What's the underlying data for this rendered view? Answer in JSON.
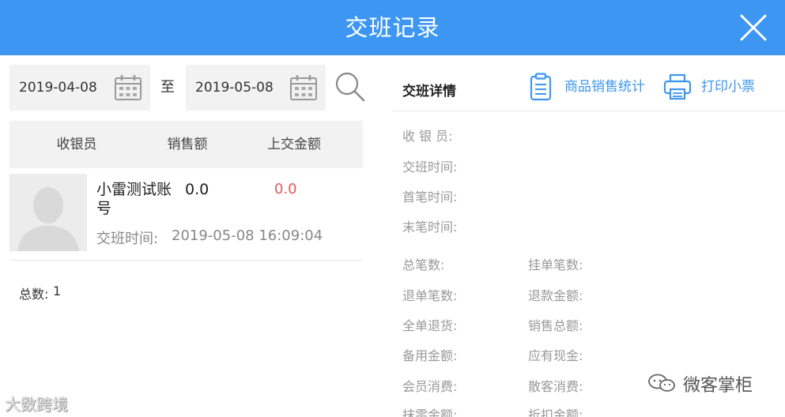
{
  "header": {
    "title": "交班记录"
  },
  "filters": {
    "start_date": "2019-04-08",
    "separator": "至",
    "end_date": "2019-05-08"
  },
  "table": {
    "columns": [
      "收银员",
      "销售额",
      "上交金额"
    ]
  },
  "records": [
    {
      "cashier": "小雷测试账号",
      "sales": "0.0",
      "amount": "0.0",
      "time_label": "交班时间:",
      "time": "2019-05-08 16:09:04"
    }
  ],
  "summary": {
    "total_label": "总数:",
    "total_value": "1"
  },
  "detail": {
    "title": "交班详情",
    "actions": {
      "stats_label": "商品销售统计",
      "print_label": "打印小票"
    },
    "fields_single": [
      "收 银 员:",
      "交班时间:",
      "首笔时间:",
      "末笔时间:"
    ],
    "fields_left": [
      "总笔数:",
      "退单笔数:",
      "全单退货:",
      "备用金额:",
      "会员消费:",
      "抹零金额:"
    ],
    "fields_right": [
      "挂单笔数:",
      "退款金额:",
      "销售总额:",
      "应有现金:",
      "散客消费:",
      "折扣金额:"
    ]
  },
  "watermarks": {
    "left": "大数跨境",
    "right": "微客掌柜"
  },
  "colors": {
    "primary": "#3d97f2",
    "amount_red": "#e05a55",
    "panel_gray": "#f2f2f2"
  },
  "icons": [
    "close-icon",
    "calendar-icon",
    "search-icon",
    "clipboard-icon",
    "printer-icon",
    "avatar-placeholder",
    "wechat-icon"
  ]
}
